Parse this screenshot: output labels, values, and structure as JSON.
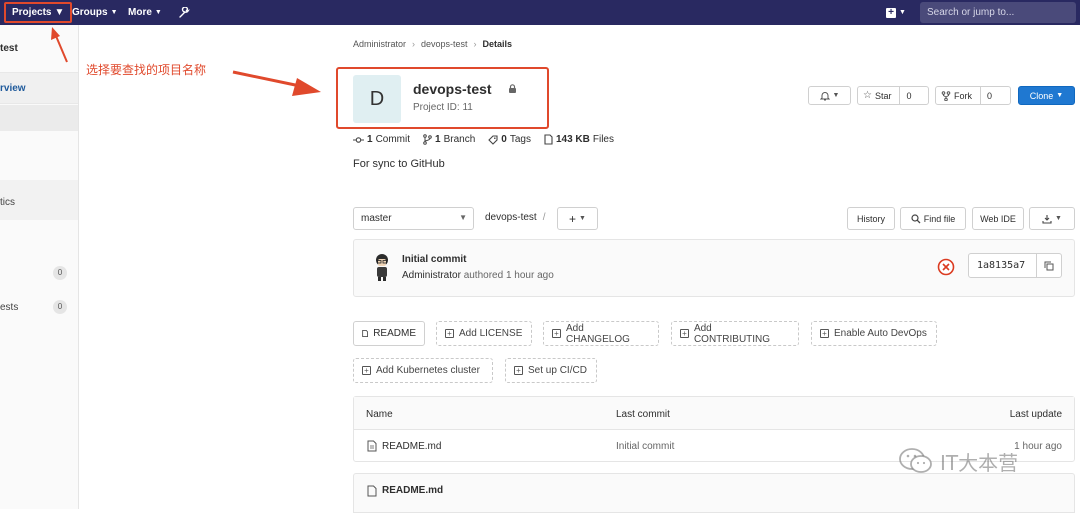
{
  "navbar": {
    "projects": "Projects",
    "groups": "Groups",
    "more": "More",
    "search_placeholder": "Search or jump to..."
  },
  "sidebar": {
    "project_partial": "test",
    "overview_partial": "rview",
    "analytics_partial": "tics",
    "issues_count": "0",
    "requests_partial": "ests",
    "requests_count": "0"
  },
  "annotation": {
    "text": "选择要查找的项目名称",
    "color": "#e0492c"
  },
  "breadcrumb": [
    "Administrator",
    "devops-test",
    "Details"
  ],
  "project": {
    "avatar_letter": "D",
    "name": "devops-test",
    "id_label": "Project ID: 11",
    "description": "For sync to GitHub"
  },
  "actions": {
    "star": "Star",
    "star_count": "0",
    "fork": "Fork",
    "fork_count": "0",
    "clone": "Clone"
  },
  "stats": {
    "commits_num": "1",
    "commits_label": "Commit",
    "branches_num": "1",
    "branches_label": "Branch",
    "tags_num": "0",
    "tags_label": "Tags",
    "files_size": "143 KB",
    "files_label": "Files"
  },
  "repo_toolbar": {
    "branch": "master",
    "path": "devops-test",
    "path_sep": "/",
    "add": "+",
    "history": "History",
    "find_file": "Find file",
    "web_ide": "Web IDE"
  },
  "last_commit": {
    "title": "Initial commit",
    "author": "Administrator",
    "authored": "authored 1 hour ago",
    "sha": "1a8135a7"
  },
  "quick_buttons": {
    "readme": "README",
    "add_license": "Add LICENSE",
    "add_changelog": "Add CHANGELOG",
    "add_contributing": "Add CONTRIBUTING",
    "enable_devops": "Enable Auto DevOps",
    "add_k8s": "Add Kubernetes cluster",
    "setup_cicd": "Set up CI/CD"
  },
  "file_table": {
    "col_name": "Name",
    "col_commit": "Last commit",
    "col_update": "Last update",
    "rows": [
      {
        "name": "README.md",
        "commit": "Initial commit",
        "updated": "1 hour ago"
      }
    ]
  },
  "readme_header": "README.md",
  "watermark": "IT大本营"
}
